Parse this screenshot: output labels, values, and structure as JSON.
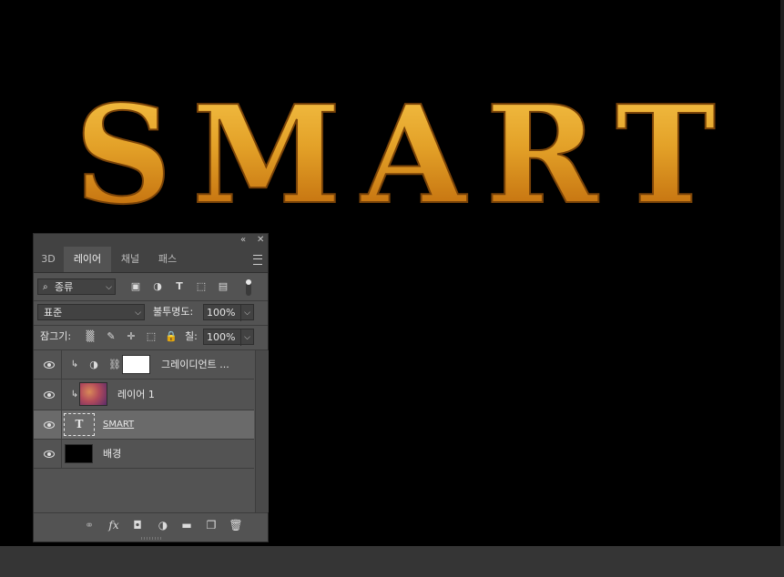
{
  "canvas": {
    "headline": "SMART"
  },
  "panel": {
    "collapse_icon": "double-chevron-left-icon",
    "close_icon": "close-icon",
    "tabs": [
      {
        "label": "3D"
      },
      {
        "label": "레이어"
      },
      {
        "label": "채널"
      },
      {
        "label": "패스"
      }
    ],
    "filter": {
      "value": "종류"
    },
    "blend_mode": {
      "value": "표준"
    },
    "opacity": {
      "label": "불투명도:",
      "value": "100%"
    },
    "lock": {
      "label": "잠그기:"
    },
    "fill": {
      "label": "칠:",
      "value": "100%"
    },
    "layers": [
      {
        "name": "그레이디언트 ...",
        "type": "adjustment",
        "thumb_color": "#ffffff"
      },
      {
        "name": "레이어 1",
        "type": "pixel"
      },
      {
        "name": "SMART",
        "type": "text",
        "selected": true
      },
      {
        "name": "배경",
        "type": "background",
        "thumb_color": "#000000"
      }
    ],
    "text_thumb_glyph": "T"
  },
  "colors": {
    "gold_light": "#f5c040",
    "gold_mid": "#d9911a",
    "gold_dark": "#8a4a08",
    "panel_bg": "#535353",
    "selected_row": "#6a6a6a"
  }
}
